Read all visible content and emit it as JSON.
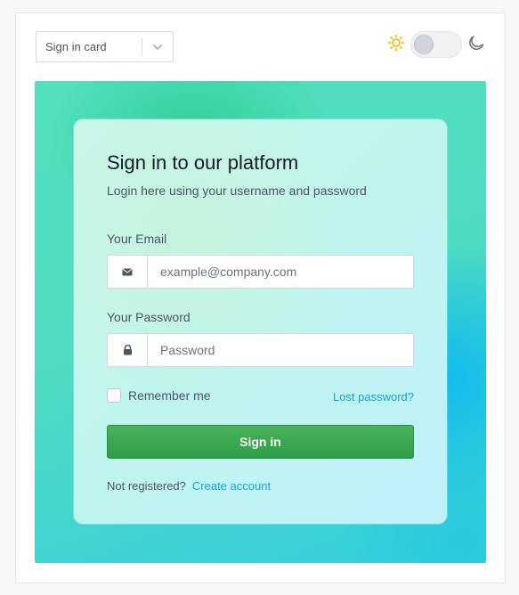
{
  "toolbar": {
    "variant_select_value": "Sign in card",
    "theme_toggle_state": "light"
  },
  "colors": {
    "accent": "#0ea5e9",
    "primary_button": "#38a853",
    "sun_icon": "#f5b400",
    "stage_gradient": [
      "#52e0bd",
      "#0bb8f0",
      "#33cfdd"
    ]
  },
  "card": {
    "title": "Sign in to our platform",
    "subtitle": "Login here using your username and password",
    "email": {
      "label": "Your Email",
      "placeholder": "example@company.com",
      "value": "",
      "icon": "envelope-icon"
    },
    "password": {
      "label": "Your Password",
      "placeholder": "Password",
      "value": "",
      "icon": "lock-icon"
    },
    "remember_label": "Remember me",
    "remember_checked": false,
    "lost_password_link": "Lost password?",
    "submit_label": "Sign in",
    "register_prompt": "Not registered?",
    "register_link": "Create account"
  },
  "icons": {
    "chevron": "chevron-down-icon",
    "light_mode": "sun-icon",
    "dark_mode": "moon-icon"
  }
}
